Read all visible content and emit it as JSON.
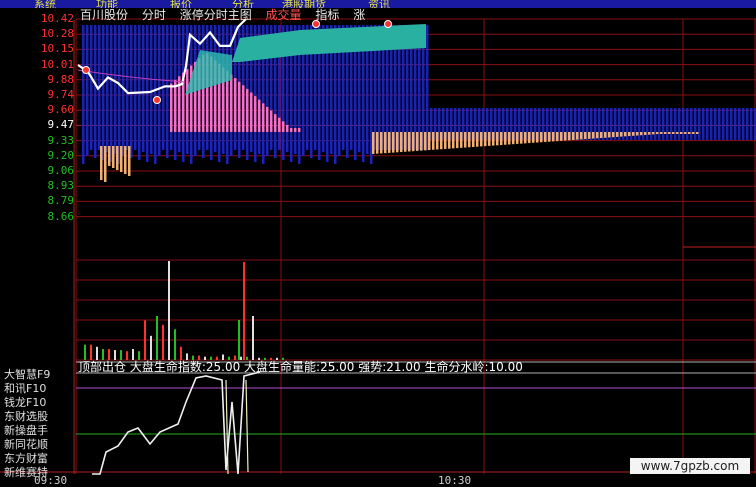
{
  "menu": [
    "系统",
    "功能",
    "报价",
    "分析",
    "港股期货",
    "资讯"
  ],
  "price_axis": [
    {
      "label": "10.42",
      "cls": "up"
    },
    {
      "label": "10.28",
      "cls": "up"
    },
    {
      "label": "10.15",
      "cls": "up"
    },
    {
      "label": "10.01",
      "cls": "up"
    },
    {
      "label": "9.88",
      "cls": "up"
    },
    {
      "label": "9.74",
      "cls": "up"
    },
    {
      "label": "9.60",
      "cls": "up"
    },
    {
      "label": "9.47",
      "cls": "flat"
    },
    {
      "label": "9.33",
      "cls": "down"
    },
    {
      "label": "9.20",
      "cls": "down"
    },
    {
      "label": "9.06",
      "cls": "down"
    },
    {
      "label": "8.93",
      "cls": "down"
    },
    {
      "label": "8.79",
      "cls": "down"
    },
    {
      "label": "8.66",
      "cls": "down"
    }
  ],
  "stock_tabs": [
    {
      "label": "百川股份",
      "hl": false
    },
    {
      "label": "分时",
      "hl": false
    },
    {
      "label": "涨停分时主图",
      "hl": false
    },
    {
      "label": "成交量",
      "hl": true
    },
    {
      "label": "指标",
      "hl": false
    },
    {
      "label": "涨",
      "hl": false
    }
  ],
  "indicator_header": "顶部出仓 大盘生命指数:25.00 大盘生命量能:25.00 强势:21.00 生命分水岭:10.00",
  "sidebar": [
    "大智慧F9",
    "和讯F10",
    "钱龙F10",
    "东财选股",
    "新操盘手",
    "新同花顺",
    "东方财富",
    "新维赛特"
  ],
  "time_axis": [
    "09:30",
    "10:30"
  ],
  "watermark": "www.7gpzb.com",
  "colors": {
    "up": "#ff3030",
    "down": "#20c020",
    "flat": "#ffffff",
    "bars": "#1e28d0",
    "grid": "#8a1010"
  },
  "chart_data": {
    "type": "line",
    "price_line": [
      10.01,
      9.95,
      9.8,
      9.9,
      9.85,
      9.76,
      9.77,
      9.82,
      9.82,
      9.84,
      10.0,
      10.28,
      10.2,
      10.3,
      10.18,
      10.18,
      10.35,
      10.42
    ],
    "volume": [
      14,
      14,
      12,
      10,
      10,
      9,
      9,
      8,
      10,
      8,
      36,
      22,
      40,
      32,
      90,
      28,
      12,
      6,
      4,
      4,
      3,
      3,
      3,
      5,
      3,
      4,
      3,
      3,
      3,
      2,
      2,
      2,
      2,
      2
    ]
  }
}
